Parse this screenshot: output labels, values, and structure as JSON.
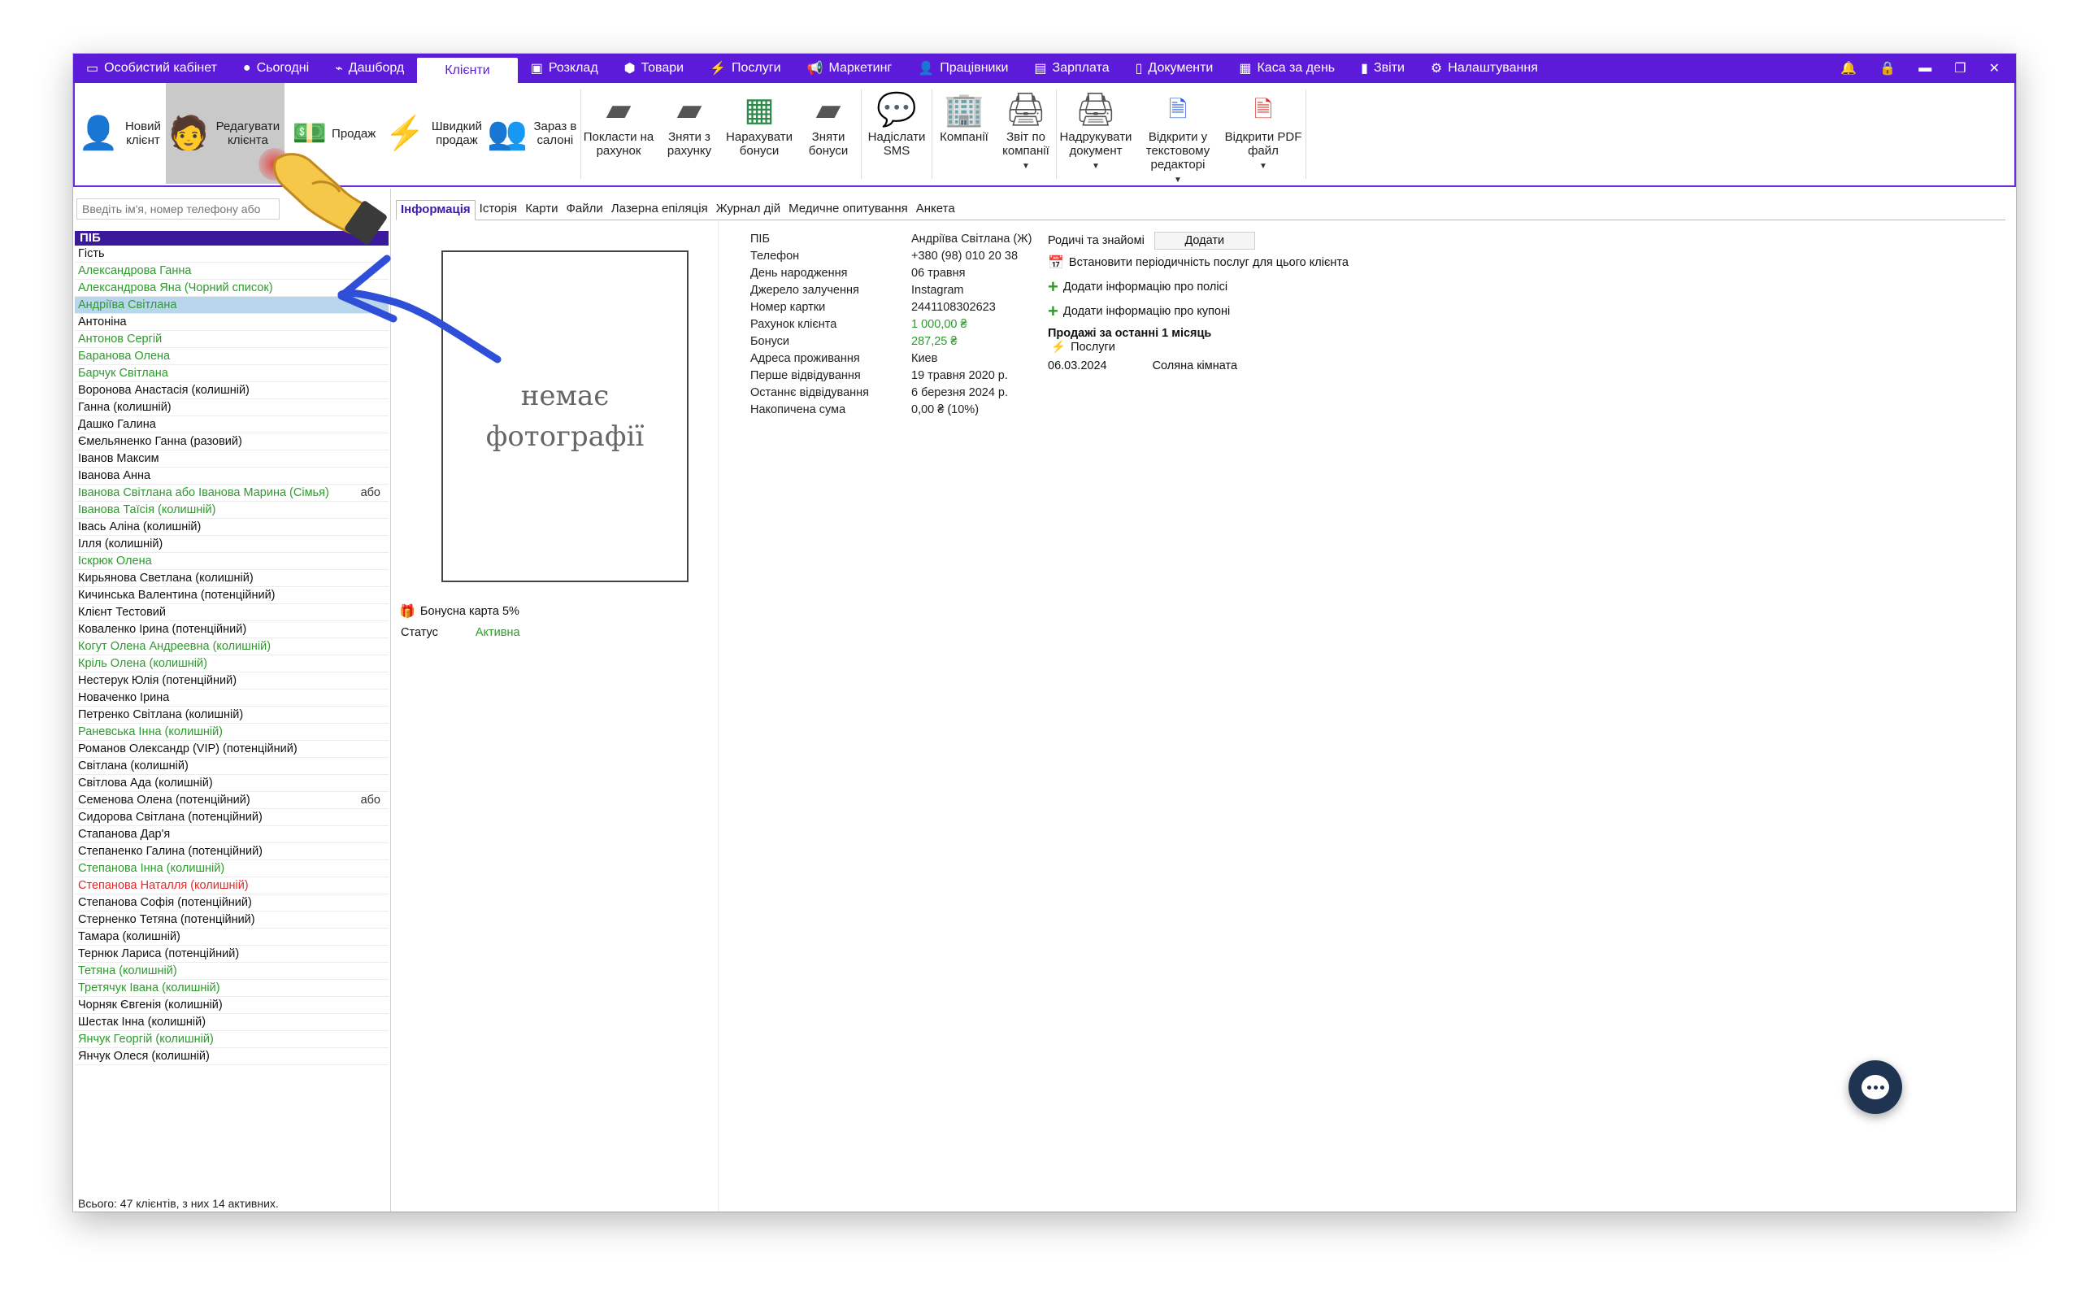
{
  "menubar": {
    "items": [
      {
        "icon": "▭",
        "label": "Особистий кабінет"
      },
      {
        "icon": "●",
        "label": "Сьогодні"
      },
      {
        "icon": "⌁",
        "label": "Дашборд"
      },
      {
        "icon": "",
        "label": "Клієнти"
      },
      {
        "icon": "▣",
        "label": "Розклад"
      },
      {
        "icon": "⬢",
        "label": "Товари"
      },
      {
        "icon": "⚡",
        "label": "Послуги"
      },
      {
        "icon": "📢",
        "label": "Маркетинг"
      },
      {
        "icon": "👤",
        "label": "Працівники"
      },
      {
        "icon": "▤",
        "label": "Зарплата"
      },
      {
        "icon": "▯",
        "label": "Документи"
      },
      {
        "icon": "▦",
        "label": "Каса за день"
      },
      {
        "icon": "▮",
        "label": "Звіти"
      },
      {
        "icon": "⚙",
        "label": "Налаштування"
      }
    ]
  },
  "ribbon": {
    "new_client": "Новий клієнт",
    "edit_client": "Редагувати клієнта",
    "sale": "Продаж",
    "quick_sale": "Швидкий продаж",
    "in_salon": "Зараз в салоні",
    "deposit": "Покласти на рахунок",
    "withdraw": "Зняти з рахунку",
    "add_bonus": "Нарахувати бонуси",
    "remove_bonus": "Зняти бонуси",
    "send_sms": "Надіслати SMS",
    "companies": "Компанії",
    "company_report": "Звіт по компанії",
    "print_doc": "Надрукувати документ",
    "open_text": "Відкрити у текстовому редакторі",
    "open_pdf": "Відкрити PDF файл"
  },
  "left": {
    "search_placeholder": "Введіть ім'я, номер телефону або",
    "header": "ПІБ",
    "clients": [
      {
        "name": "Гість",
        "color": "black",
        "extra": ""
      },
      {
        "name": "Александрова Ганна",
        "color": "green",
        "extra": ""
      },
      {
        "name": "Александрова Яна (Чорний список)",
        "color": "green",
        "extra": ""
      },
      {
        "name": "Андріїва Світлана",
        "color": "green",
        "extra": "",
        "selected": true
      },
      {
        "name": "Антоніна",
        "color": "black",
        "extra": ""
      },
      {
        "name": "Антонов Сергій",
        "color": "green",
        "extra": ""
      },
      {
        "name": "Баранова Олена",
        "color": "green",
        "extra": ""
      },
      {
        "name": "Барчук Світлана",
        "color": "green",
        "extra": ""
      },
      {
        "name": "Воронова Анастасія (колишній)",
        "color": "black",
        "extra": ""
      },
      {
        "name": "Ганна (колишній)",
        "color": "black",
        "extra": ""
      },
      {
        "name": "Дашко Галина",
        "color": "black",
        "extra": ""
      },
      {
        "name": "Ємельяненко Ганна (разовий)",
        "color": "black",
        "extra": ""
      },
      {
        "name": "Іванов Максим",
        "color": "black",
        "extra": ""
      },
      {
        "name": "Іванова Анна",
        "color": "black",
        "extra": ""
      },
      {
        "name": "Іванова Світлана або Іванова Марина (Сімья)",
        "color": "green",
        "extra": "або"
      },
      {
        "name": "Іванова Таїсія (колишній)",
        "color": "green",
        "extra": ""
      },
      {
        "name": "Івась Аліна (колишній)",
        "color": "black",
        "extra": ""
      },
      {
        "name": "Ілля (колишній)",
        "color": "black",
        "extra": ""
      },
      {
        "name": "Іскрюк Олена",
        "color": "green",
        "extra": ""
      },
      {
        "name": "Кирьянова Светлана (колишній)",
        "color": "black",
        "extra": ""
      },
      {
        "name": "Кичинська Валентина (потенційний)",
        "color": "black",
        "extra": ""
      },
      {
        "name": "Клієнт Тестовий",
        "color": "black",
        "extra": ""
      },
      {
        "name": "Коваленко Ірина (потенційний)",
        "color": "black",
        "extra": ""
      },
      {
        "name": "Когут Олена Андреевна (колишній)",
        "color": "green",
        "extra": ""
      },
      {
        "name": "Кріль Олена (колишній)",
        "color": "green",
        "extra": ""
      },
      {
        "name": "Нестерук Юлія (потенційний)",
        "color": "black",
        "extra": ""
      },
      {
        "name": "Новаченко Ірина",
        "color": "black",
        "extra": ""
      },
      {
        "name": "Петренко Світлана (колишній)",
        "color": "black",
        "extra": ""
      },
      {
        "name": "Раневська Інна (колишній)",
        "color": "green",
        "extra": ""
      },
      {
        "name": "Романов Олександр (VIP) (потенційний)",
        "color": "black",
        "extra": ""
      },
      {
        "name": "Світлана (колишній)",
        "color": "black",
        "extra": ""
      },
      {
        "name": "Світлова Ада (колишній)",
        "color": "black",
        "extra": ""
      },
      {
        "name": "Семенова Олена (потенційний)",
        "color": "black",
        "extra": "або"
      },
      {
        "name": "Сидорова Світлана (потенційний)",
        "color": "black",
        "extra": ""
      },
      {
        "name": "Стапанова Дар'я",
        "color": "black",
        "extra": ""
      },
      {
        "name": "Степаненко Галина (потенційний)",
        "color": "black",
        "extra": ""
      },
      {
        "name": "Степанова Інна (колишній)",
        "color": "green",
        "extra": ""
      },
      {
        "name": "Степанова Наталля (колишній)",
        "color": "red",
        "extra": ""
      },
      {
        "name": "Степанова Софія (потенційний)",
        "color": "black",
        "extra": ""
      },
      {
        "name": "Стерненко Тетяна (потенційний)",
        "color": "black",
        "extra": ""
      },
      {
        "name": "Тамара (колишній)",
        "color": "black",
        "extra": ""
      },
      {
        "name": "Тернюк Лариса (потенційний)",
        "color": "black",
        "extra": ""
      },
      {
        "name": "Тетяна (колишній)",
        "color": "green",
        "extra": ""
      },
      {
        "name": "Третячук Івана (колишній)",
        "color": "green",
        "extra": ""
      },
      {
        "name": "Чорняк Євгенія (колишній)",
        "color": "black",
        "extra": ""
      },
      {
        "name": "Шестак Інна (колишній)",
        "color": "black",
        "extra": ""
      },
      {
        "name": "Янчук Георгій (колишній)",
        "color": "green",
        "extra": ""
      },
      {
        "name": "Янчук Олеся (колишній)",
        "color": "black",
        "extra": ""
      }
    ],
    "total": "Всього: 47 клієнтів, з них 14 активних."
  },
  "tabs": [
    "Інформація",
    "Історія",
    "Карти",
    "Файли",
    "Лазерна епіляція",
    "Журнал дій",
    "Медичне опитування",
    "Анкета"
  ],
  "photo": {
    "line1": "немає",
    "line2": "фотографії"
  },
  "bonus_card": "Бонусна карта 5%",
  "status": {
    "label": "Статус",
    "value": "Активна"
  },
  "info": [
    {
      "label": "ПІБ",
      "value": "Андріїва Світлана (Ж)",
      "color": "black"
    },
    {
      "label": "Телефон",
      "value": "+380 (98) 010 20 38",
      "color": "black"
    },
    {
      "label": "День народження",
      "value": "06 травня",
      "color": "black"
    },
    {
      "label": "Джерело залучення",
      "value": "Instagram",
      "color": "black"
    },
    {
      "label": "Номер картки",
      "value": "2441108302623",
      "color": "black"
    },
    {
      "label": "Рахунок клієнта",
      "value": "1 000,00 ₴",
      "color": "green"
    },
    {
      "label": "Бонуси",
      "value": "287,25 ₴",
      "color": "green"
    },
    {
      "label": "Адреса проживання",
      "value": "Киев",
      "color": "black"
    },
    {
      "label": "Перше відвідування",
      "value": "19 травня 2020 р.",
      "color": "black"
    },
    {
      "label": "Останнє відвідування",
      "value": "6 березня 2024 р.",
      "color": "black"
    },
    {
      "label": "Накопичена сума",
      "value": "0,00 ₴ (10%)",
      "color": "black"
    }
  ],
  "side": {
    "relatives_label": "Родичі та знайомі",
    "add_button": "Додати",
    "set_periodicity": "Встановити періодичність послуг для цього клієнта",
    "add_policy": "Додати інформацію про полісі",
    "add_coupon": "Додати інформацію про купоні",
    "sales_title": "Продажі за останні 1 місяць",
    "services_label": "Послуги",
    "sale_date": "06.03.2024",
    "sale_name": "Соляна кімната"
  },
  "colors": {
    "accent": "#5b1bd8",
    "green": "#2e9a2e",
    "red": "#e02a2a",
    "selected_row": "#b9d7ec"
  }
}
